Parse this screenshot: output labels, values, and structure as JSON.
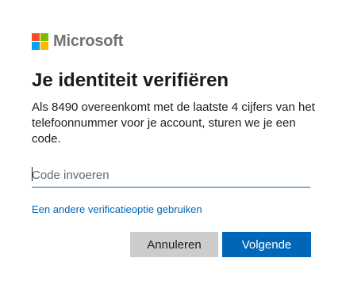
{
  "brand": {
    "name": "Microsoft",
    "colors": {
      "red": "#f25022",
      "green": "#7fba00",
      "blue": "#00a4ef",
      "yellow": "#ffb900",
      "text": "#737373"
    }
  },
  "title": "Je identiteit verifiëren",
  "description": "Als 8490 overeenkomt met de laatste 4 cijfers van het telefoonnummer voor je account, sturen we je een code.",
  "code_input": {
    "placeholder": "Code invoeren",
    "value": ""
  },
  "alt_link": "Een andere verificatieoptie gebruiken",
  "buttons": {
    "cancel": "Annuleren",
    "next": "Volgende"
  },
  "accent_color": "#0067b8"
}
